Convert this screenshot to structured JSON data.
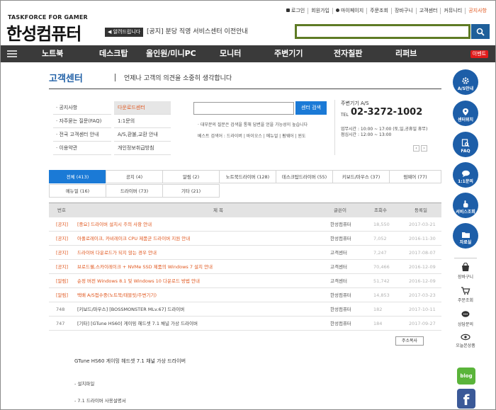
{
  "top_links": [
    "로그인",
    "회원가입",
    "마이페이지",
    "주문조회",
    "장바구니",
    "고객센터",
    "커뮤니티",
    "공지사항"
  ],
  "logo": {
    "sub": "TASKFORCE FOR GAMER",
    "main": "한성컴퓨터"
  },
  "notice": {
    "tag": "◀ 알려드립니다",
    "text": "[공지] 분당 직영 서비스센터 이전안내"
  },
  "nav": {
    "items": [
      "노트북",
      "데스크탑",
      "올인원/미니PC",
      "모니터",
      "주변기기",
      "전자칠판",
      "리퍼브"
    ],
    "event": "이벤트"
  },
  "cs": {
    "title": "고객센터",
    "subtitle": "언제나 고객의 의견을 소중히 생각합니다",
    "menu_left": [
      "공지사항",
      "자주묻는 질문(FAQ)",
      "전국 고객센터 안내",
      "이용약관"
    ],
    "menu_right": [
      "다운로드센터",
      "1:1문의",
      "A/S,환불,교환 안내",
      "개인정보취급방침"
    ],
    "search_btn": "센터 검색",
    "desc": "대부분의 질문은 검색을 통해 답변을 얻을 가능성이 높습니다",
    "best": "베스트 검색어 : 드라이버 | 바이오스 | 메뉴얼 | 펌웨어 | 윈도",
    "as_label": "주변기기 A/S",
    "tel_label": "TEL",
    "tel": "02-3272-1002",
    "hours1": "업무시간 : 10:00 ~ 17:00 (토,일,공휴일 휴무)",
    "hours2": "점심시간 : 12:00 ~ 13:00"
  },
  "tabs": [
    "전체 (413)",
    "공지 (4)",
    "알림 (2)",
    "노트북드라이버 (128)",
    "데스크탑드라이버 (55)",
    "키보드/마우스 (37)",
    "펌웨어 (77)",
    "메뉴얼 (16)",
    "드라이버 (73)",
    "기타 (21)"
  ],
  "table": {
    "headers": {
      "no": "번호",
      "title": "제 목",
      "author": "글쓴이",
      "views": "조회수",
      "date": "등록일"
    },
    "rows": [
      {
        "no": "[공지]",
        "title": "[중요] 드라이버 설치시 주의 사항 안내",
        "author": "한성컴퓨터",
        "views": "18,550",
        "date": "2017-03-21"
      },
      {
        "no": "[공지]",
        "title": "아폴로레이크, 카비레이크 CPU 제품군 드라이버 지원 안내",
        "author": "한성컴퓨터",
        "views": "7,052",
        "date": "2016-11-30"
      },
      {
        "no": "[공지]",
        "title": "드라이버 다운로드가 되지 않는 경우 안내",
        "author": "고객센터",
        "views": "7,247",
        "date": "2017-08-07"
      },
      {
        "no": "[공지]",
        "title": "브로드웰,스카이레이크 + NVMe SSD 제품의 Windows 7 설치 안내",
        "author": "고객센터",
        "views": "70,466",
        "date": "2016-12-09"
      },
      {
        "no": "[알림]",
        "title": "순정 버전 Windows 8.1 및 Windows 10 다운로드 방법 안내",
        "author": "고객센터",
        "views": "51,742",
        "date": "2016-12-09"
      },
      {
        "no": "[알림]",
        "title": "택배 A/S접수중(노트북/태블릿/주변기기)",
        "author": "한성컴퓨터",
        "views": "14,853",
        "date": "2017-03-23"
      },
      {
        "no": "748",
        "title": "[키보드/마우스] [BOSSMONSTER MLv.67] 드라이버",
        "author": "한성컴퓨터",
        "views": "182",
        "date": "2017-10-11"
      },
      {
        "no": "747",
        "title": "[기타] [GTune HS60] 게이밍 헤드셋 7.1 채널 가상 드라이버",
        "author": "한성컴퓨터",
        "views": "184",
        "date": "2017-09-27"
      }
    ]
  },
  "more_btn": "주소복사",
  "article": {
    "title": "GTune HS60 게이밍 헤드셋 7.1 채널 가상 드라이버",
    "b1": "- 설치파일",
    "b2": "- 7.1 드라이버 사용설명서"
  },
  "quickbar": {
    "circles": [
      "A/S안내",
      "센터위치",
      "FAQ",
      "1:1문의",
      "서비스조회",
      "자료실"
    ],
    "small": [
      "장바구니",
      "주문조회",
      "상담문의",
      "오늘본상품"
    ],
    "blog": "blog",
    "fb": "f"
  },
  "colors": {
    "nav_bg": "#3a3a3a",
    "accent_blue": "#1b7ad6",
    "quick_blue": "#1d5ea8",
    "notice_orange": "#e0561d",
    "search_green": "#5e7b25"
  }
}
